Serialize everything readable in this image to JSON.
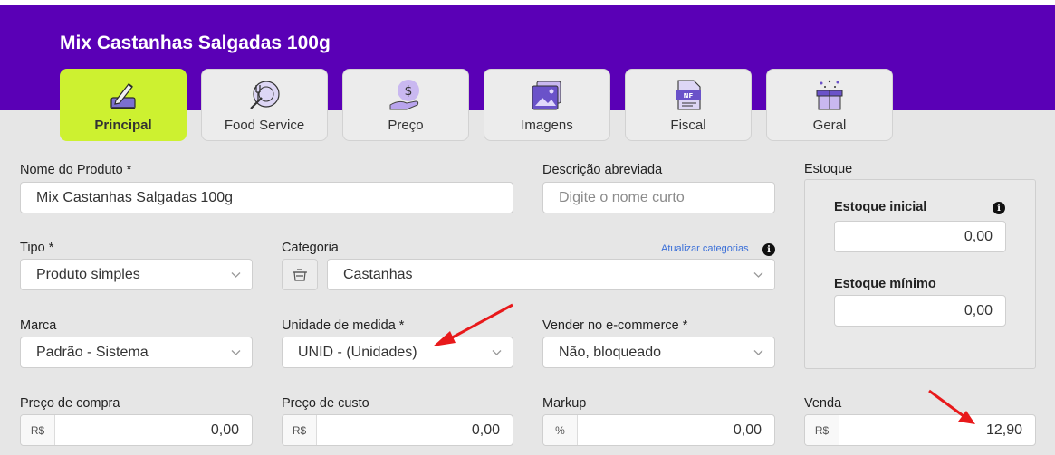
{
  "product_title": "Mix Castanhas Salgadas 100g",
  "tabs": [
    {
      "label": "Principal",
      "icon": "pencil-edit-icon",
      "active": true
    },
    {
      "label": "Food Service",
      "icon": "food-service-icon",
      "active": false
    },
    {
      "label": "Preço",
      "icon": "money-hand-icon",
      "active": false
    },
    {
      "label": "Imagens",
      "icon": "images-icon",
      "active": false
    },
    {
      "label": "Fiscal",
      "icon": "fiscal-nf-icon",
      "active": false
    },
    {
      "label": "Geral",
      "icon": "gift-box-icon",
      "active": false
    }
  ],
  "form": {
    "nome": {
      "label": "Nome do Produto *",
      "value": "Mix Castanhas Salgadas 100g"
    },
    "descricao": {
      "label": "Descrição abreviada",
      "placeholder": "Digite o nome curto"
    },
    "tipo": {
      "label": "Tipo *",
      "value": "Produto simples"
    },
    "categoria": {
      "label": "Categoria",
      "value": "Castanhas",
      "update_link": "Atualizar categorias"
    },
    "marca": {
      "label": "Marca",
      "value": "Padrão - Sistema"
    },
    "unidade": {
      "label": "Unidade de medida *",
      "value": "UNID - (Unidades)"
    },
    "ecommerce": {
      "label": "Vender no e-commerce *",
      "value": "Não, bloqueado"
    },
    "preco_compra": {
      "label": "Preço de compra",
      "prefix": "R$",
      "value": "0,00"
    },
    "preco_custo": {
      "label": "Preço de custo",
      "prefix": "R$",
      "value": "0,00"
    },
    "markup": {
      "label": "Markup",
      "prefix": "%",
      "value": "0,00"
    },
    "venda": {
      "label": "Venda",
      "prefix": "R$",
      "value": "12,90"
    }
  },
  "estoque": {
    "title": "Estoque",
    "inicial_label": "Estoque inicial",
    "inicial_value": "0,00",
    "minimo_label": "Estoque mínimo",
    "minimo_value": "0,00",
    "info_glyph": "i"
  },
  "colors": {
    "header_purple": "#5a00b6",
    "active_tab": "#cdf130",
    "annotation_red": "#e8191b"
  }
}
